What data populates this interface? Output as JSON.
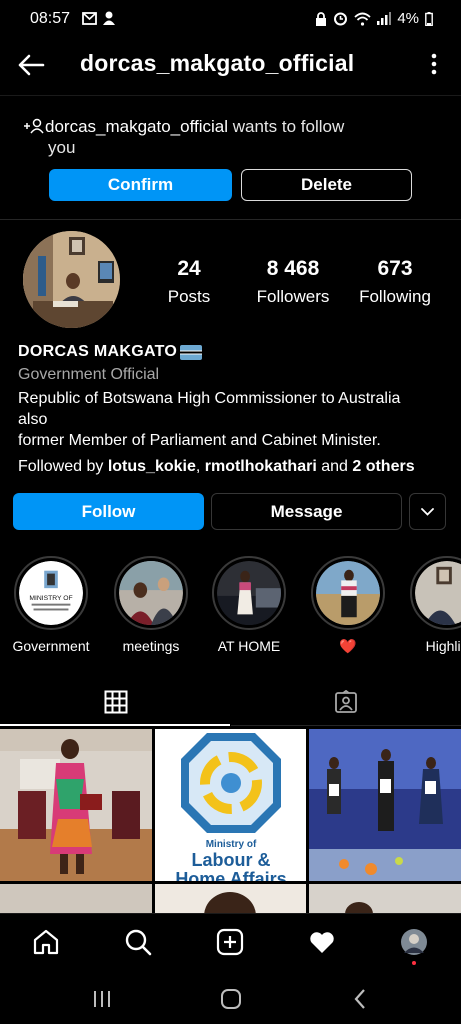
{
  "status_bar": {
    "time": "08:57",
    "battery": "4%"
  },
  "header": {
    "username": "dorcas_makgato_official"
  },
  "follow_request": {
    "username": "dorcas_makgato_official",
    "text_line1_suffix": " wants to follow",
    "text_line2": "you",
    "confirm_label": "Confirm",
    "delete_label": "Delete"
  },
  "profile": {
    "stats": [
      {
        "value": "24",
        "label": "Posts"
      },
      {
        "value": "8 468",
        "label": "Followers"
      },
      {
        "value": "673",
        "label": "Following"
      }
    ],
    "name": "DORCAS MAKGATO",
    "category": "Government Official",
    "bio_line1": "Republic of Botswana High Commissioner to Australia",
    "bio_line2": "also",
    "bio_line3": "former Member of Parliament and Cabinet Minister.",
    "followed_prefix": "Followed by ",
    "followed_user1": "lotus_kokie",
    "followed_sep": ", ",
    "followed_user2": "rmotlhokathari",
    "followed_and": " and ",
    "followed_others": "2 others",
    "follow_label": "Follow",
    "message_label": "Message"
  },
  "highlights": [
    {
      "label": "Government",
      "ring_text": "MINISTRY OF"
    },
    {
      "label": "meetings"
    },
    {
      "label": "AT HOME"
    },
    {
      "label": "❤️"
    },
    {
      "label": "Highlig"
    }
  ],
  "grid": {
    "post2_line1": "Ministry of",
    "post2_line2": "Labour &",
    "post2_line3": "Home Affairs"
  },
  "colors": {
    "accent": "#0095f6",
    "background": "#000000",
    "secondary_text": "#a8a8a8"
  }
}
